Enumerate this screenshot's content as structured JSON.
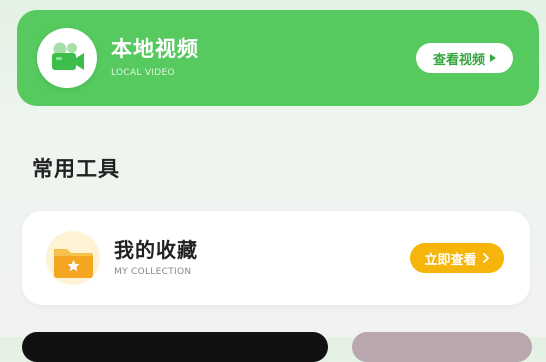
{
  "local_video": {
    "title": "本地视频",
    "subtitle": "LOCAL VIDEO",
    "button_label": "查看视频",
    "icon": "video-camera-icon"
  },
  "tools": {
    "section_title": "常用工具",
    "collection": {
      "title": "我的收藏",
      "subtitle": "MY COLLECTION",
      "button_label": "立即查看",
      "icon": "folder-star-icon"
    }
  },
  "colors": {
    "green_accent": "#56c95f",
    "yellow_accent": "#f6b50b"
  }
}
